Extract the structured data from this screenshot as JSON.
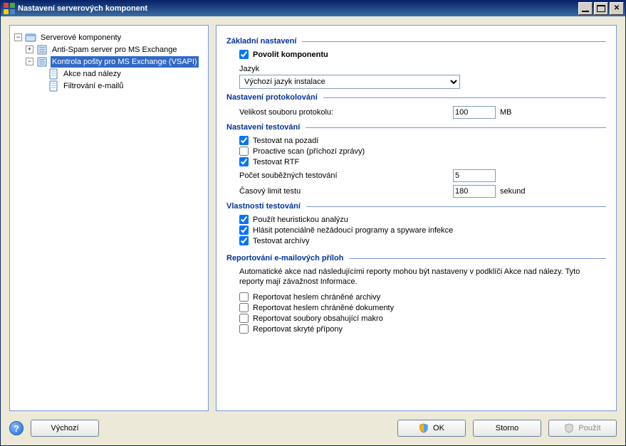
{
  "window": {
    "title": "Nastavení serverových komponent"
  },
  "tree": {
    "root": {
      "label": "Serverové komponenty"
    },
    "antispam": {
      "label": "Anti-Spam server pro MS Exchange"
    },
    "vsapi": {
      "label": "Kontrola pošty pro MS Exchange (VSAPI)"
    },
    "actions": {
      "label": "Akce nad nálezy"
    },
    "filtering": {
      "label": "Filtrování e-mailů"
    }
  },
  "basic": {
    "header": "Základní nastavení",
    "enable_label": "Povolit komponentu",
    "enable_checked": true,
    "language_label": "Jazyk",
    "language_selected": "Výchozí jazyk instalace"
  },
  "logging": {
    "header": "Nastavení protokolování",
    "size_label": "Velikost souboru protokolu:",
    "size_value": "100",
    "size_unit": "MB"
  },
  "testing": {
    "header": "Nastavení testování",
    "bg_label": "Testovat na pozadí",
    "bg_checked": true,
    "proactive_label": "Proactive scan (příchozí zprávy)",
    "proactive_checked": false,
    "rtf_label": "Testovat RTF",
    "rtf_checked": true,
    "concurrent_label": "Počet souběžných testování",
    "concurrent_value": "5",
    "timeout_label": "Časový limit testu",
    "timeout_value": "180",
    "timeout_unit": "sekund"
  },
  "properties": {
    "header": "Vlastnosti testování",
    "heur_label": "Použít heuristickou analýzu",
    "heur_checked": true,
    "pup_label": "Hlásit potenciálně nežádoucí programy a spyware infekce",
    "pup_checked": true,
    "arch_label": "Testovat archívy",
    "arch_checked": true
  },
  "reporting": {
    "header": "Reportování e-mailových příloh",
    "description": "Automatické akce nad následujícími reporty mohou být nastaveny v podklíči Akce nad nálezy. Tyto reporty mají závažnost Informace.",
    "pw_arch_label": "Reportovat heslem chráněné archivy",
    "pw_arch_checked": false,
    "pw_doc_label": "Reportovat heslem chráněné dokumenty",
    "pw_doc_checked": false,
    "macro_label": "Reportovat soubory obsahující makro",
    "macro_checked": false,
    "hidden_label": "Reportovat skryté přípony",
    "hidden_checked": false
  },
  "buttons": {
    "default": "Výchozí",
    "ok": "OK",
    "cancel": "Storno",
    "apply": "Použít"
  }
}
